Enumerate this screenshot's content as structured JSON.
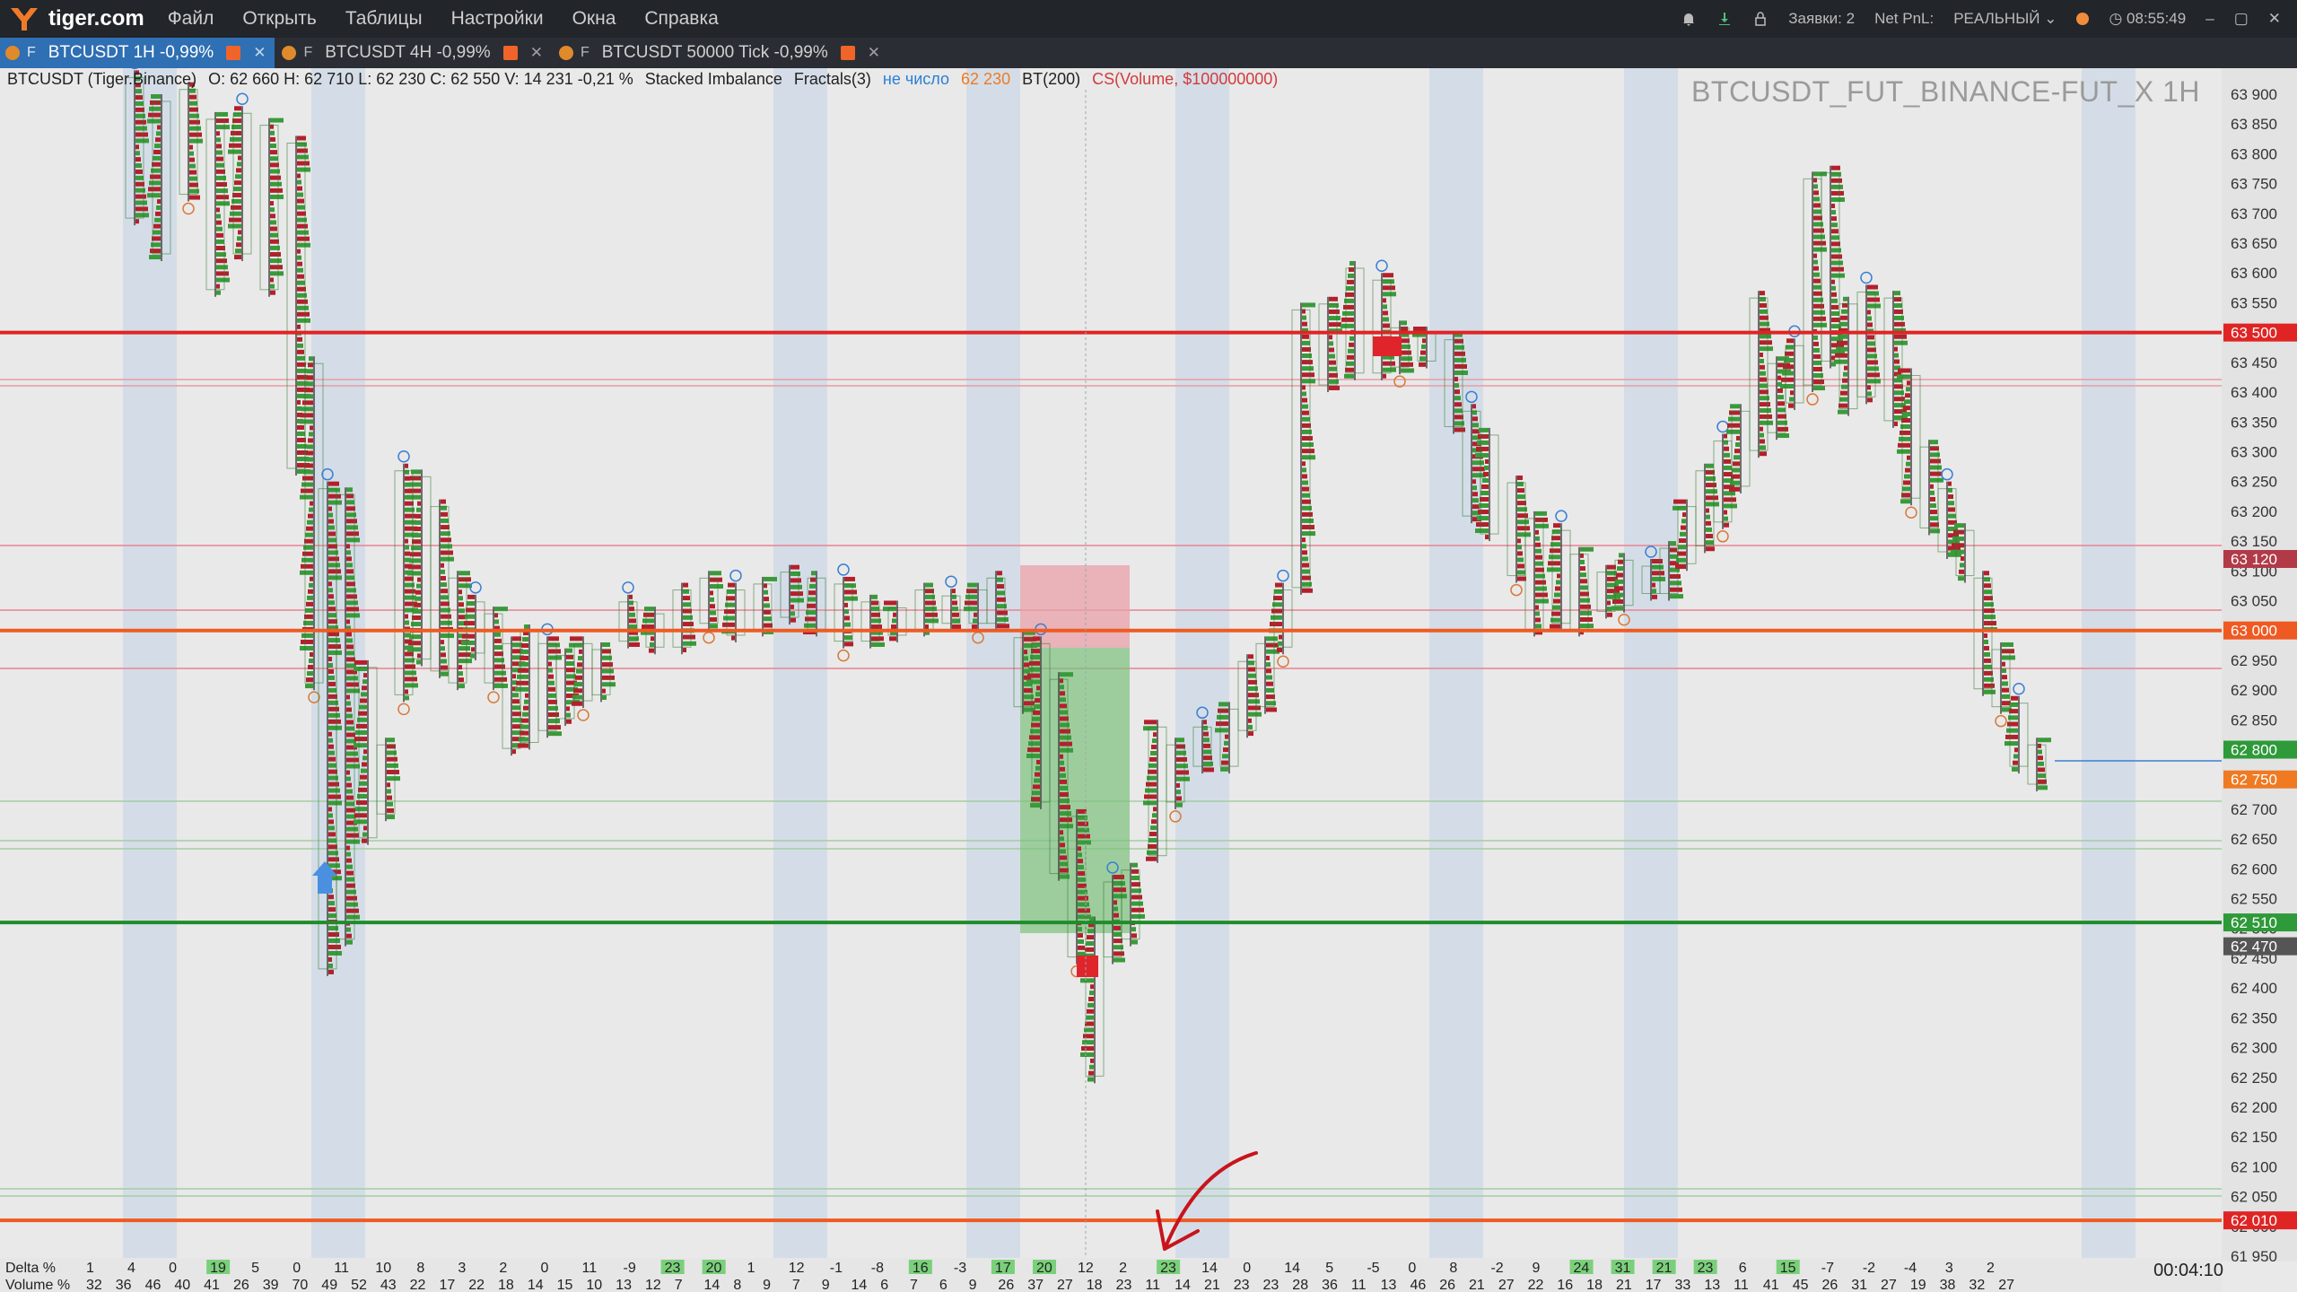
{
  "app": {
    "brand": "tiger.com",
    "menu": [
      "Файл",
      "Открыть",
      "Таблицы",
      "Настройки",
      "Окна",
      "Справка"
    ],
    "orders_label": "Заявки: 2",
    "netpnl_label": "Net PnL:",
    "mode_label": "РЕАЛЬНЫЙ",
    "clock": "08:55:49"
  },
  "tabs": [
    {
      "prefix": "F",
      "label": "BTCUSDT 1H -0,99%",
      "active": true
    },
    {
      "prefix": "F",
      "label": "BTCUSDT 4H -0,99%",
      "active": false
    },
    {
      "prefix": "F",
      "label": "BTCUSDT 50000 Tick -0,99%",
      "active": false
    }
  ],
  "info": {
    "symbol": "BTCUSDT (Tiger.Binance)",
    "ohlcv": "O: 62 660  H: 62 710  L: 62 230  C: 62 550  V: 14 231  -0,21 %",
    "ind1": "Stacked Imbalance",
    "ind2": "Fractals(3)",
    "ind3": "не число",
    "ind3_value": "62 230",
    "ind4": "BT(200)",
    "ind5": "CS(Volume, $100000000)"
  },
  "watermark": "BTCUSDT_FUT_BINANCE-FUT_X  1H",
  "price_axis": {
    "ticks": [
      "63 900",
      "63 850",
      "63 800",
      "63 750",
      "63 700",
      "63 650",
      "63 600",
      "63 550",
      "63 500",
      "63 450",
      "63 400",
      "63 350",
      "63 300",
      "63 250",
      "63 200",
      "63 150",
      "63 100",
      "63 050",
      "63 000",
      "62 950",
      "62 900",
      "62 850",
      "62 800",
      "62 750",
      "62 700",
      "62 650",
      "62 600",
      "62 550",
      "62 500",
      "62 450",
      "62 400",
      "62 350",
      "62 300",
      "62 250",
      "62 200",
      "62 150",
      "62 100",
      "62 050",
      "62 000",
      "61 950"
    ],
    "tags": [
      {
        "text": "63 500",
        "price": 63500,
        "color": "#e02424"
      },
      {
        "text": "63 120",
        "price": 63120,
        "color": "#b23a48"
      },
      {
        "text": "63 000",
        "price": 63000,
        "color": "#ef5a22"
      },
      {
        "text": "62 800",
        "price": 62800,
        "color": "#2e9a3a"
      },
      {
        "text": "62 750",
        "price": 62750,
        "color": "#ef7a22"
      },
      {
        "text": "62 510",
        "price": 62510,
        "color": "#2e9a3a"
      },
      {
        "text": "62 470",
        "price": 62470,
        "color": "#555555"
      },
      {
        "text": "62 010",
        "price": 62010,
        "color": "#e02424"
      }
    ]
  },
  "levels": [
    {
      "price": 63500,
      "color": "#e02424"
    },
    {
      "price": 63000,
      "color": "#ef5a22"
    },
    {
      "price": 62510,
      "color": "#1f8c2a"
    },
    {
      "price": 62010,
      "color": "#ef5a22"
    }
  ],
  "bottom": {
    "delta_label": "Delta %",
    "volume_label": "Volume %",
    "delta_values": [
      "1",
      "4",
      "0",
      "19",
      "5",
      "0",
      "11",
      "10",
      "8",
      "3",
      "2",
      "0",
      "11",
      "-9",
      "23",
      "20",
      "1",
      "12",
      "-1",
      "-8",
      "16",
      "-3",
      "17",
      "20",
      "12",
      "2",
      "23",
      "14",
      "0",
      "14",
      "5",
      "-5",
      "0",
      "8",
      "-2",
      "9",
      "24",
      "31",
      "21",
      "23",
      "6",
      "15",
      "-7",
      "-2",
      "-4",
      "3",
      "2"
    ],
    "volume_values": [
      "32",
      "36",
      "46",
      "40",
      "41",
      "26",
      "39",
      "70",
      "49",
      "52",
      "43",
      "22",
      "17",
      "22",
      "18",
      "14",
      "15",
      "10",
      "13",
      "12",
      "7",
      "14",
      "8",
      "9",
      "7",
      "9",
      "14",
      "6",
      "7",
      "6",
      "9",
      "26",
      "37",
      "27",
      "18",
      "23",
      "11",
      "14",
      "21",
      "23",
      "23",
      "28",
      "36",
      "11",
      "13",
      "46",
      "26",
      "21",
      "27",
      "22",
      "16",
      "18",
      "21",
      "17",
      "33",
      "13",
      "11",
      "41",
      "45",
      "26",
      "31",
      "27",
      "19",
      "38",
      "32",
      "27"
    ],
    "timer": "00:04:10"
  },
  "colors": {
    "bull": "#3a9a3a",
    "bear": "#b3202c",
    "band": "#c9d7e6"
  }
}
